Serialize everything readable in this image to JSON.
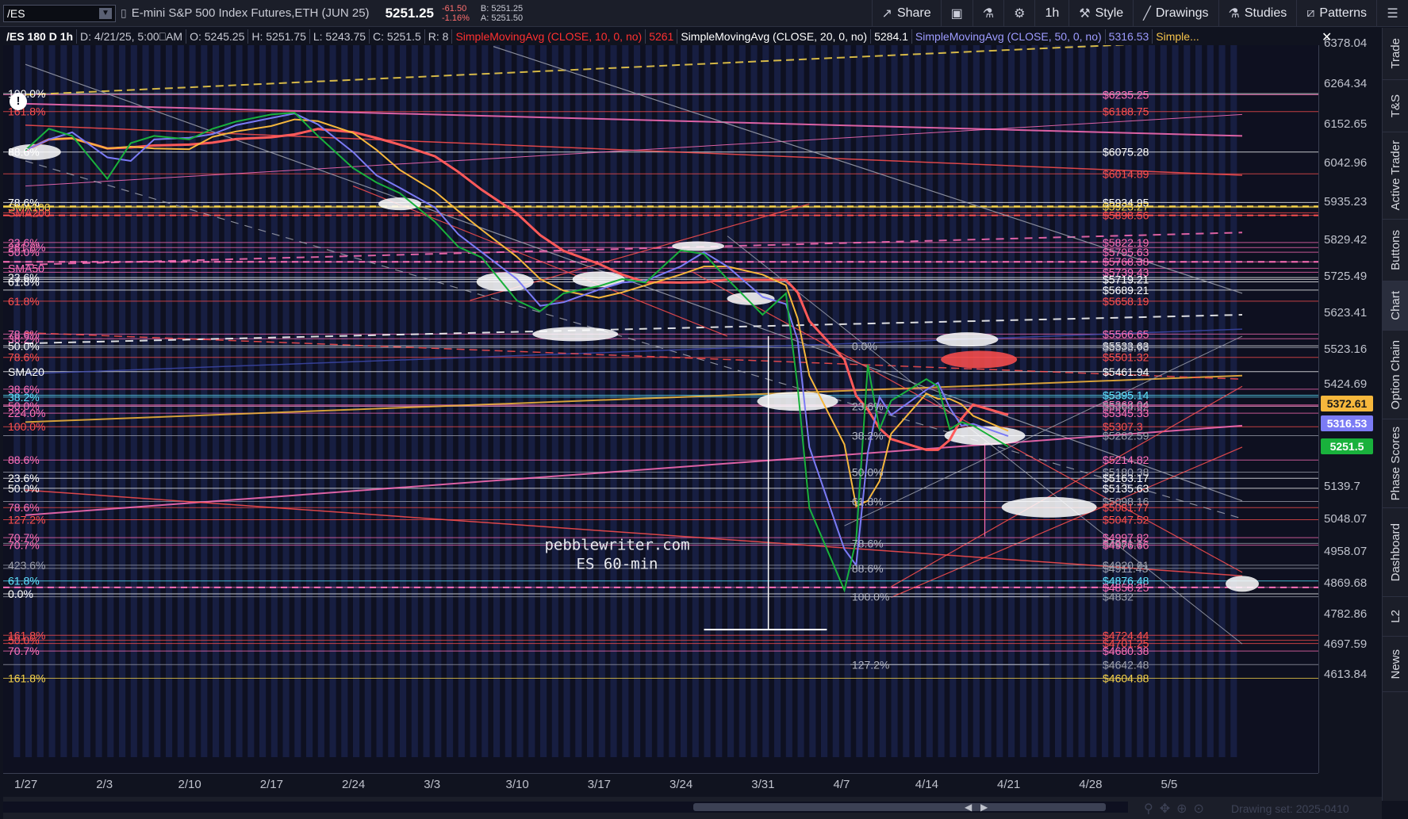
{
  "toolbar": {
    "symbol": "/ES",
    "instrument": "E-mini S&P 500 Index Futures,ETH (JUN 25)",
    "last_price": "5251.25",
    "change": "-61.50",
    "change_pct": "-1.16%",
    "bid": "B: 5251.25",
    "ask": "A: 5251.50",
    "share_label": "Share",
    "timeframe_label": "1h",
    "style_label": "Style",
    "drawings_label": "Drawings",
    "studies_label": "Studies",
    "patterns_label": "Patterns"
  },
  "infostrip": {
    "chart_id": "/ES 180 D 1h",
    "date": "D: 4/21/25, 5:00⎕AM",
    "open": "O: 5245.25",
    "high": "H: 5251.75",
    "low": "L: 5243.75",
    "close": "C: 5251.5",
    "range": "R: 8",
    "sma10_label": "SimpleMovingAvg (CLOSE, 10, 0, no)",
    "sma10_value": "5261",
    "sma20_label": "SimpleMovingAvg (CLOSE, 20, 0, no)",
    "sma20_value": "5284.1",
    "sma50_label": "SimpleMovingAvg (CLOSE, 50, 0, no)",
    "sma50_value": "5316.53",
    "more_label": "Simple..."
  },
  "watermark": {
    "line1": "pebblewriter.com",
    "line2": "ES 60-min"
  },
  "price_axis": {
    "ticks": [
      "6378.04",
      "6264.34",
      "6152.65",
      "6042.96",
      "5935.23",
      "5829.42",
      "5725.49",
      "5623.41",
      "5523.16",
      "5424.69",
      "5139.7",
      "5048.07",
      "4958.07",
      "4869.68",
      "4782.86",
      "4697.59",
      "4613.84"
    ],
    "badges": [
      {
        "label": "5372.61",
        "bg": "#f6b73c",
        "fg": "#1a1a1a",
        "price": 5372.61
      },
      {
        "label": "5316.53",
        "bg": "#7b7bf5",
        "fg": "#ffffff",
        "price": 5316.53
      },
      {
        "label": "5251.5",
        "bg": "#19b13c",
        "fg": "#ffffff",
        "price": 5251.5
      }
    ]
  },
  "date_axis": {
    "ticks": [
      "1/27",
      "2/3",
      "2/10",
      "2/17",
      "2/24",
      "3/3",
      "3/10",
      "3/17",
      "3/24",
      "3/31",
      "4/7",
      "4/14",
      "4/21",
      "4/28",
      "5/5"
    ]
  },
  "side_tabs": [
    "Trade",
    "T&S",
    "Active Trader",
    "Buttons",
    "Chart",
    "Option Chain",
    "Phase Scores",
    "Dashboard",
    "L2",
    "News"
  ],
  "side_tab_active": "Chart",
  "footer": {
    "drawing_set": "Drawing set: 2025-0410"
  },
  "left_labels": [
    {
      "text": "100.0%",
      "color": "#ffffff",
      "price": 6238
    },
    {
      "text": "161.8%",
      "color": "#ff4f4f",
      "price": 6188
    },
    {
      "text": "88.6%",
      "color": "#ffffff",
      "price": 6075
    },
    {
      "text": "78.6%",
      "color": "#ffffff",
      "price": 5934
    },
    {
      "text": "SMA100",
      "color": "#f6d34b",
      "price": 5920
    },
    {
      "text": "SMA200",
      "color": "#ff4f4f",
      "price": 5905
    },
    {
      "text": "23.6%",
      "color": "#ff6fb8",
      "price": 5822
    },
    {
      "text": "261.8%",
      "color": "#ff6fb8",
      "price": 5808
    },
    {
      "text": "50.0%",
      "color": "#ff6fb8",
      "price": 5795
    },
    {
      "text": "SMA50",
      "color": "#ff6fb8",
      "price": 5750
    },
    {
      "text": "23.6%",
      "color": "#ffffff",
      "price": 5724
    },
    {
      "text": "61.8%",
      "color": "#ffffff",
      "price": 5712
    },
    {
      "text": "61.8%",
      "color": "#ff4f4f",
      "price": 5658
    },
    {
      "text": "78.6%",
      "color": "#ff6fb8",
      "price": 5566
    },
    {
      "text": "38.2%",
      "color": "#ff6fb8",
      "price": 5553
    },
    {
      "text": "50.0%",
      "color": "#ffffff",
      "price": 5533
    },
    {
      "text": "78.6%",
      "color": "#ff4f4f",
      "price": 5501
    },
    {
      "text": "SMA20",
      "color": "#ffffff",
      "price": 5461
    },
    {
      "text": "38.6%",
      "color": "#ff6fb8",
      "price": 5412
    },
    {
      "text": "38.2%",
      "color": "#5fe3ff",
      "price": 5390
    },
    {
      "text": "50.0%",
      "color": "#ff6fb8",
      "price": 5365
    },
    {
      "text": "224.0%",
      "color": "#ff6fb8",
      "price": 5345
    },
    {
      "text": "100.0%",
      "color": "#ff4f4f",
      "price": 5307
    },
    {
      "text": "88.6%",
      "color": "#ff6fb8",
      "price": 5214
    },
    {
      "text": "23.6%",
      "color": "#ffffff",
      "price": 5163
    },
    {
      "text": "50.0%",
      "color": "#ffffff",
      "price": 5135
    },
    {
      "text": "78.6%",
      "color": "#ff6fb8",
      "price": 5081
    },
    {
      "text": "127.2%",
      "color": "#ff4f4f",
      "price": 5047
    },
    {
      "text": "70.7%",
      "color": "#ff6fb8",
      "price": 4997
    },
    {
      "text": "70.7%",
      "color": "#ff6fb8",
      "price": 4976
    },
    {
      "text": "423.6%",
      "color": "#9da0ad",
      "price": 4920
    },
    {
      "text": "61.8%",
      "color": "#5fe3ff",
      "price": 4876
    },
    {
      "text": "0.0%",
      "color": "#ffffff",
      "price": 4840
    },
    {
      "text": "161.8%",
      "color": "#ff4f4f",
      "price": 4724
    },
    {
      "text": "50.0%",
      "color": "#ff4f4f",
      "price": 4710
    },
    {
      "text": "70.7%",
      "color": "#ff6fb8",
      "price": 4680
    },
    {
      "text": "161.8%",
      "color": "#f6d34b",
      "price": 4604
    }
  ],
  "right_labels": [
    {
      "text": "$6235.25",
      "color": "#ff6fb8",
      "price": 6235
    },
    {
      "text": "$6188.75",
      "color": "#ff4f4f",
      "price": 6188
    },
    {
      "text": "$6075.28",
      "color": "#ffffff",
      "price": 6075
    },
    {
      "text": "$6014.89",
      "color": "#ff4f4f",
      "price": 6014
    },
    {
      "text": "$5934.95",
      "color": "#ffffff",
      "price": 5934
    },
    {
      "text": "$5923.27",
      "color": "#f6d34b",
      "price": 5923
    },
    {
      "text": "$5898.56",
      "color": "#ff4f4f",
      "price": 5898
    },
    {
      "text": "$5822.19",
      "color": "#ff6fb8",
      "price": 5822
    },
    {
      "text": "$5795.63",
      "color": "#ff6fb8",
      "price": 5795
    },
    {
      "text": "$5768.38",
      "color": "#ff6fb8",
      "price": 5768
    },
    {
      "text": "$5739.43",
      "color": "#ff6fb8",
      "price": 5739
    },
    {
      "text": "$5719.21",
      "color": "#ffffff",
      "price": 5719
    },
    {
      "text": "$5689.21",
      "color": "#ffffff",
      "price": 5689
    },
    {
      "text": "$5658.19",
      "color": "#ff4f4f",
      "price": 5658
    },
    {
      "text": "$5566.65",
      "color": "#ff6fb8",
      "price": 5566
    },
    {
      "text": "$5533.63",
      "color": "#ffffff",
      "price": 5533
    },
    {
      "text": "$5528.75",
      "color": "#9da0ad",
      "price": 5528
    },
    {
      "text": "$5501.32",
      "color": "#ff4f4f",
      "price": 5501
    },
    {
      "text": "$5461.94",
      "color": "#ffffff",
      "price": 5461
    },
    {
      "text": "$5395.14",
      "color": "#5fe3ff",
      "price": 5395
    },
    {
      "text": "$5368.04",
      "color": "#ff6fb8",
      "price": 5368
    },
    {
      "text": "$5364.32",
      "color": "#9da0ad",
      "price": 5364
    },
    {
      "text": "$5345.33",
      "color": "#ff6fb8",
      "price": 5345
    },
    {
      "text": "$5307.3",
      "color": "#ff4f4f",
      "price": 5307
    },
    {
      "text": "$5282.59",
      "color": "#9da0ad",
      "price": 5282
    },
    {
      "text": "$5214.82",
      "color": "#ff6fb8",
      "price": 5214
    },
    {
      "text": "$5180.38",
      "color": "#9da0ad",
      "price": 5180
    },
    {
      "text": "$5163.17",
      "color": "#ffffff",
      "price": 5163
    },
    {
      "text": "$5135.63",
      "color": "#ffffff",
      "price": 5135
    },
    {
      "text": "$5098.16",
      "color": "#9da0ad",
      "price": 5098
    },
    {
      "text": "$5081.77",
      "color": "#ff4f4f",
      "price": 5081
    },
    {
      "text": "$5047.52",
      "color": "#ff4f4f",
      "price": 5047
    },
    {
      "text": "$4997.82",
      "color": "#ff6fb8",
      "price": 4997
    },
    {
      "text": "$4981.1",
      "color": "#9da0ad",
      "price": 4981
    },
    {
      "text": "$4976.66",
      "color": "#ff6fb8",
      "price": 4976
    },
    {
      "text": "$4920.61",
      "color": "#9da0ad",
      "price": 4920
    },
    {
      "text": "$4911.43",
      "color": "#9da0ad",
      "price": 4911
    },
    {
      "text": "$4876.48",
      "color": "#5fe3ff",
      "price": 4876
    },
    {
      "text": "$4858.25",
      "color": "#ff6fb8",
      "price": 4858
    },
    {
      "text": "$4832",
      "color": "#9da0ad",
      "price": 4832
    },
    {
      "text": "$4724.44",
      "color": "#ff4f4f",
      "price": 4724
    },
    {
      "text": "$4701.25",
      "color": "#ff4f4f",
      "price": 4701
    },
    {
      "text": "$4680.38",
      "color": "#ff6fb8",
      "price": 4680
    },
    {
      "text": "$4642.48",
      "color": "#9da0ad",
      "price": 4642
    },
    {
      "text": "$4604.88",
      "color": "#f6d34b",
      "price": 4604
    }
  ],
  "fib_labels": [
    {
      "text": "0.0%",
      "price": 5533,
      "date": 70.5
    },
    {
      "text": "23.6%",
      "price": 5364,
      "date": 70.5
    },
    {
      "text": "38.2%",
      "price": 5282,
      "date": 70.5
    },
    {
      "text": "50.0%",
      "price": 5180,
      "date": 70.5
    },
    {
      "text": "61.8%",
      "price": 5098,
      "date": 70.5
    },
    {
      "text": "78.6%",
      "price": 4981,
      "date": 70.5
    },
    {
      "text": "88.6%",
      "price": 4911,
      "date": 70.5
    },
    {
      "text": "100.0%",
      "price": 4832,
      "date": 70.5
    },
    {
      "text": "127.2%",
      "price": 4642,
      "date": 70.5
    }
  ],
  "chart_data": {
    "type": "line",
    "symbol": "/ES",
    "timeframe": "1h",
    "x_start": "1/27",
    "x_end": "5/5",
    "ylim": [
      4590,
      6390
    ],
    "price_series": [
      {
        "date": "1/27",
        "close": 6080
      },
      {
        "date": "1/29",
        "close": 6140
      },
      {
        "date": "1/31",
        "close": 6120
      },
      {
        "date": "2/3",
        "close": 6000
      },
      {
        "date": "2/5",
        "close": 6100
      },
      {
        "date": "2/7",
        "close": 6120
      },
      {
        "date": "2/10",
        "close": 6110
      },
      {
        "date": "2/12",
        "close": 6140
      },
      {
        "date": "2/14",
        "close": 6160
      },
      {
        "date": "2/17",
        "close": 6180
      },
      {
        "date": "2/19",
        "close": 6185
      },
      {
        "date": "2/21",
        "close": 6120
      },
      {
        "date": "2/24",
        "close": 6030
      },
      {
        "date": "2/26",
        "close": 5990
      },
      {
        "date": "2/28",
        "close": 5960
      },
      {
        "date": "3/3",
        "close": 5880
      },
      {
        "date": "3/5",
        "close": 5810
      },
      {
        "date": "3/7",
        "close": 5780
      },
      {
        "date": "3/10",
        "close": 5660
      },
      {
        "date": "3/12",
        "close": 5630
      },
      {
        "date": "3/14",
        "close": 5680
      },
      {
        "date": "3/17",
        "close": 5700
      },
      {
        "date": "3/19",
        "close": 5720
      },
      {
        "date": "3/21",
        "close": 5710
      },
      {
        "date": "3/24",
        "close": 5800
      },
      {
        "date": "3/26",
        "close": 5790
      },
      {
        "date": "3/28",
        "close": 5720
      },
      {
        "date": "3/31",
        "close": 5620
      },
      {
        "date": "4/2",
        "close": 5680
      },
      {
        "date": "4/3",
        "close": 5420
      },
      {
        "date": "4/4",
        "close": 5080
      },
      {
        "date": "4/7",
        "close": 4850
      },
      {
        "date": "4/8",
        "close": 4990
      },
      {
        "date": "4/9",
        "close": 5480
      },
      {
        "date": "4/10",
        "close": 5300
      },
      {
        "date": "4/11",
        "close": 5380
      },
      {
        "date": "4/14",
        "close": 5440
      },
      {
        "date": "4/15",
        "close": 5420
      },
      {
        "date": "4/16",
        "close": 5300
      },
      {
        "date": "4/17",
        "close": 5320
      },
      {
        "date": "4/18",
        "close": 5310
      },
      {
        "date": "4/21",
        "close": 5251.5
      }
    ]
  }
}
